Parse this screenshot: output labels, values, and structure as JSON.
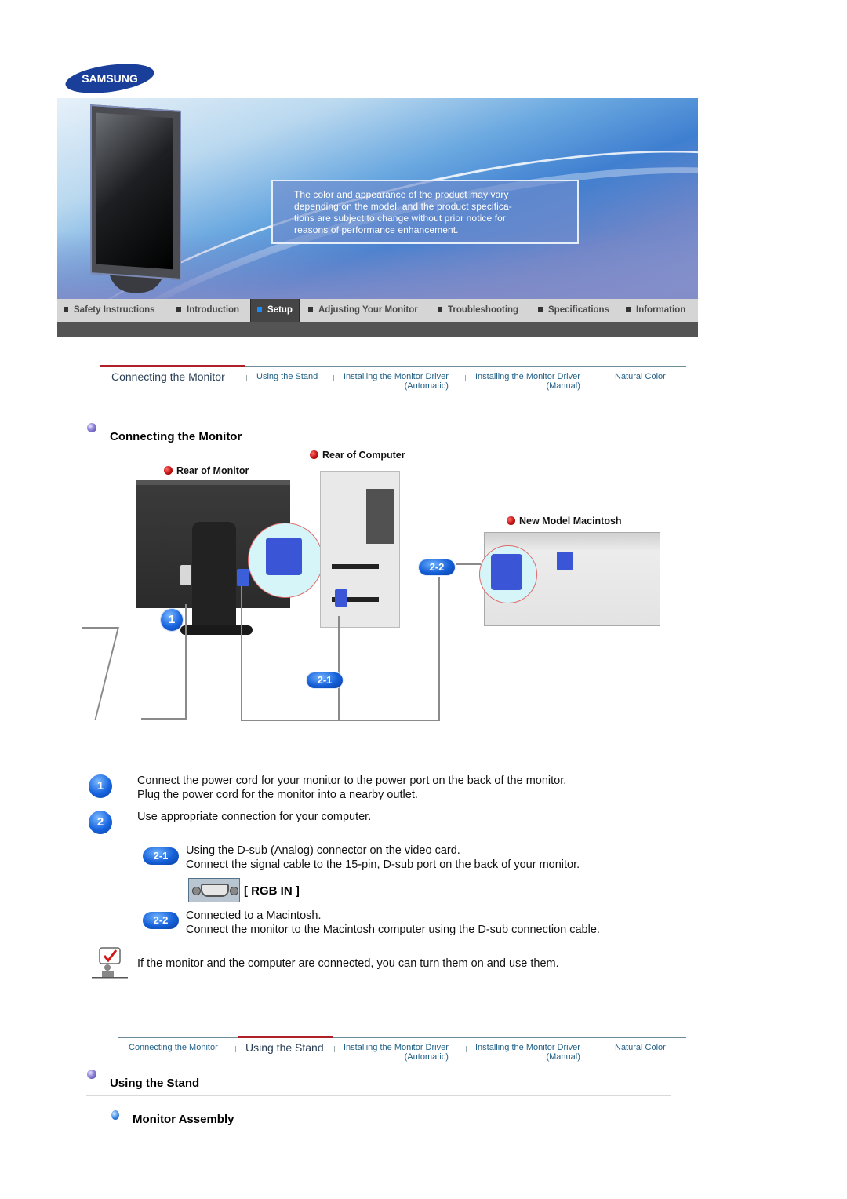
{
  "brand": {
    "logo_text": "SAMSUNG",
    "logo_color": "#1a3f9a"
  },
  "banner": {
    "notice_lines": [
      "The color and appearance of the product may vary",
      "depending on the model, and the product specifica-",
      "tions are subject to change without prior notice for",
      "reasons of performance enhancement."
    ]
  },
  "main_nav": {
    "items": [
      {
        "label": "Safety Instructions",
        "active": false
      },
      {
        "label": "Introduction",
        "active": false
      },
      {
        "label": "Setup",
        "active": true
      },
      {
        "label": "Adjusting Your Monitor",
        "active": false
      },
      {
        "label": "Troubleshooting",
        "active": false
      },
      {
        "label": "Specifications",
        "active": false
      },
      {
        "label": "Information",
        "active": false
      }
    ]
  },
  "sub_tabs": [
    {
      "label": "Connecting  the  Monitor",
      "sub": ""
    },
    {
      "label": "Using the Stand",
      "sub": ""
    },
    {
      "label": "Installing the Monitor Driver",
      "sub": "(Automatic)"
    },
    {
      "label": "Installing the Monitor Driver",
      "sub": "(Manual)"
    },
    {
      "label": "Natural Color",
      "sub": ""
    }
  ],
  "section1": {
    "heading": "Connecting the Monitor",
    "diagram": {
      "labels": {
        "rear_monitor": "Rear of Monitor",
        "rear_computer": "Rear of Computer",
        "mac": "New Model Macintosh"
      },
      "badges": {
        "one": "1",
        "two_one": "2-1",
        "two_two": "2-2"
      }
    },
    "steps": [
      {
        "badge": "1",
        "lines": [
          "Connect the power cord for your monitor to the power port on the back of the monitor.",
          "Plug the power cord for the monitor into a nearby outlet."
        ]
      },
      {
        "badge": "2",
        "lines": [
          "Use appropriate connection for your computer."
        ]
      }
    ],
    "substeps": [
      {
        "badge": "2-1",
        "lines": [
          "Using the D-sub (Analog) connector on the video card.",
          "Connect the signal cable to the 15-pin, D-sub port on the back of your monitor."
        ]
      },
      {
        "badge": "2-2",
        "lines": [
          "Connected to a Macintosh.",
          "Connect the monitor to the Macintosh computer using the D-sub connection cable."
        ]
      }
    ],
    "port_label": "[ RGB IN ]",
    "note": "If the monitor and the computer are connected, you can turn them on and use them."
  },
  "section2": {
    "heading": "Using the Stand",
    "subheading": "Monitor Assembly"
  },
  "colors": {
    "active_tab_underline": "#b02028",
    "tab_text": "#1f5f86",
    "badge_blue": "#1560d8"
  }
}
